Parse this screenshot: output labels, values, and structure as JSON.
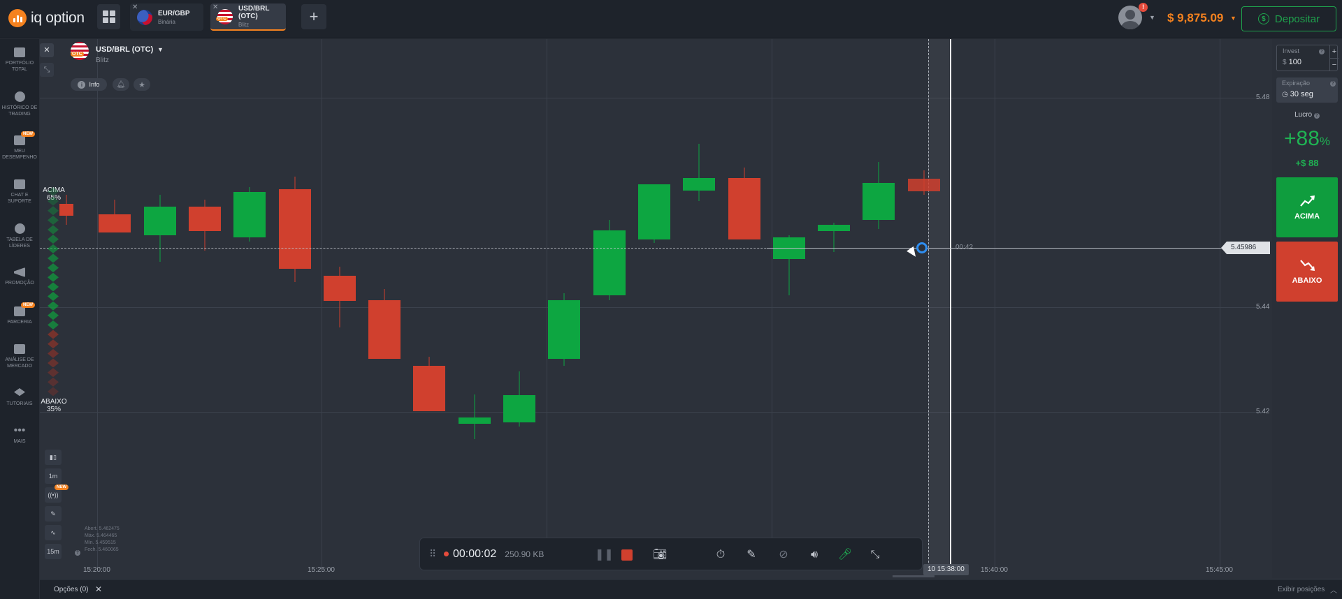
{
  "app": {
    "logo_text": "iq option",
    "balance": "$ 9,875.09",
    "deposit_label": "Depositar",
    "notification_count": "!",
    "colors": {
      "accent": "#f5821f",
      "up": "#0da641",
      "down": "#d0402e",
      "background": "#2c313a"
    }
  },
  "tabs": [
    {
      "title": "EUR/GBP",
      "subtitle": "Binária"
    },
    {
      "title": "USD/BRL (OTC)",
      "subtitle": "Blitz"
    }
  ],
  "sidebar": {
    "items": [
      {
        "label": "PORTFÓLIO TOTAL",
        "icon": "briefcase-icon"
      },
      {
        "label": "HISTÓRICO DE TRADING",
        "icon": "clock-icon"
      },
      {
        "label": "MEU DESEMPENHO",
        "icon": "dashboard-icon",
        "badge": "NEW"
      },
      {
        "label": "CHAT E SUPORTE",
        "icon": "chat-icon"
      },
      {
        "label": "TABELA DE LÍDERES",
        "icon": "trophy-icon"
      },
      {
        "label": "PROMOÇÃO",
        "icon": "megaphone-icon"
      },
      {
        "label": "PARCERIA",
        "icon": "partner-icon",
        "badge": "NEW"
      },
      {
        "label": "ANÁLISE DE MERCADO",
        "icon": "analysis-icon"
      },
      {
        "label": "TUTORIAIS",
        "icon": "graduation-cap-icon"
      },
      {
        "label": "MAIS",
        "icon": "more-icon"
      }
    ]
  },
  "asset": {
    "name": "USD/BRL (OTC)",
    "type": "Blitz",
    "info_label": "Info",
    "otc_badge": "OTC"
  },
  "sentiment": {
    "up_label": "ACIMA",
    "up_pct": "65%",
    "down_label": "ABAIXO",
    "down_pct": "35%",
    "up_fraction": 0.65
  },
  "chart_tools": {
    "timeframe": "1m",
    "interval": "15m",
    "signal_badge": "NEW"
  },
  "ohlc": {
    "open": "Abert. 5.462475",
    "max": "Máx. 5.464465",
    "min": "Mín. 5.459515",
    "close": "Fech. 5.460065"
  },
  "chart_data": {
    "type": "candlestick",
    "y_ticks": [
      "5.48",
      "5.44",
      "5.42"
    ],
    "x_ticks": [
      "15:20:00",
      "15:25:00",
      "15:40:00",
      "15:45:00"
    ],
    "expiry_time": "10 15:38:00",
    "countdown": "00:42",
    "current_price": "5.45986",
    "candles": [
      {
        "o": 5.4598,
        "c": 5.4575,
        "h": 5.4615,
        "l": 5.4558
      },
      {
        "o": 5.4578,
        "c": 5.4543,
        "h": 5.4605,
        "l": 5.4543
      },
      {
        "o": 5.4538,
        "c": 5.4592,
        "h": 5.4615,
        "l": 5.4487
      },
      {
        "o": 5.4592,
        "c": 5.4545,
        "h": 5.4605,
        "l": 5.4508
      },
      {
        "o": 5.4533,
        "c": 5.462,
        "h": 5.463,
        "l": 5.4525
      },
      {
        "o": 5.4625,
        "c": 5.4473,
        "h": 5.465,
        "l": 5.4448
      },
      {
        "o": 5.446,
        "c": 5.4412,
        "h": 5.4477,
        "l": 5.4362
      },
      {
        "o": 5.4413,
        "c": 5.4302,
        "h": 5.4435,
        "l": 5.4302
      },
      {
        "o": 5.4288,
        "c": 5.4202,
        "h": 5.4305,
        "l": 5.4202
      },
      {
        "o": 5.4177,
        "c": 5.419,
        "h": 5.4233,
        "l": 5.4148
      },
      {
        "o": 5.418,
        "c": 5.4232,
        "h": 5.4278,
        "l": 5.4172
      },
      {
        "o": 5.4302,
        "c": 5.4413,
        "h": 5.4427,
        "l": 5.4288
      },
      {
        "o": 5.4423,
        "c": 5.4547,
        "h": 5.4567,
        "l": 5.4413
      },
      {
        "o": 5.453,
        "c": 5.4635,
        "h": 5.4635,
        "l": 5.4523
      },
      {
        "o": 5.4623,
        "c": 5.4647,
        "h": 5.4712,
        "l": 5.4603
      },
      {
        "o": 5.4647,
        "c": 5.453,
        "h": 5.4667,
        "l": 5.453
      },
      {
        "o": 5.4492,
        "c": 5.4533,
        "h": 5.4538,
        "l": 5.4423
      },
      {
        "o": 5.4545,
        "c": 5.4558,
        "h": 5.4562,
        "l": 5.4505
      },
      {
        "o": 5.4567,
        "c": 5.4637,
        "h": 5.4677,
        "l": 5.455
      },
      {
        "o": 5.4645,
        "c": 5.4622,
        "h": 5.4662,
        "l": 5.4615
      }
    ]
  },
  "recorder": {
    "time": "00:00:02",
    "size": "250.90 KB"
  },
  "trade_panel": {
    "invest_label": "Invest",
    "invest_currency": "$",
    "invest_value": "100",
    "expiry_label": "Expiração",
    "expiry_value": "30 seg",
    "profit_label": "Lucro",
    "profit_pct": "+88",
    "profit_pct_sign": "%",
    "profit_amount": "+$ 88",
    "up_button": "ACIMA",
    "down_button": "ABAIXO"
  },
  "bottom": {
    "options_label": "Opções (0)",
    "show_positions": "Exibir posições"
  }
}
